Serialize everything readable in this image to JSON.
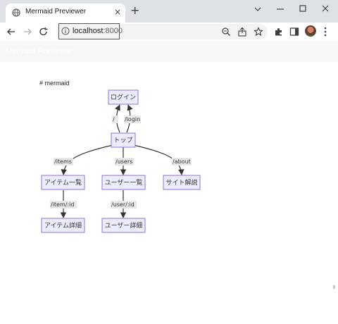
{
  "browser": {
    "tab_title": "Mermaid Previewer",
    "new_tab_symbol": "+",
    "close_symbol": "×",
    "url_host": "localhost",
    "url_port": ":8000"
  },
  "app": {
    "header_title": "Mermaid Previewer"
  },
  "content": {
    "code_label": "# mermaid"
  },
  "diagram": {
    "nodes": {
      "login": "ログイン",
      "top": "トップ",
      "items": "アイテム一覧",
      "users": "ユーザー一覧",
      "about": "サイト解説",
      "item_detail": "アイテム詳細",
      "user_detail": "ユーザー詳細"
    },
    "edges": {
      "top_to_login": "/",
      "login_to_top": "/login",
      "to_items": "/items",
      "to_users": "/users",
      "to_about": "/about",
      "to_item_detail": "/item/:id",
      "to_user_detail": "/user/:id"
    }
  },
  "colors": {
    "node_fill": "#ececff",
    "node_stroke": "#9370db",
    "highlight": "#d62020"
  }
}
